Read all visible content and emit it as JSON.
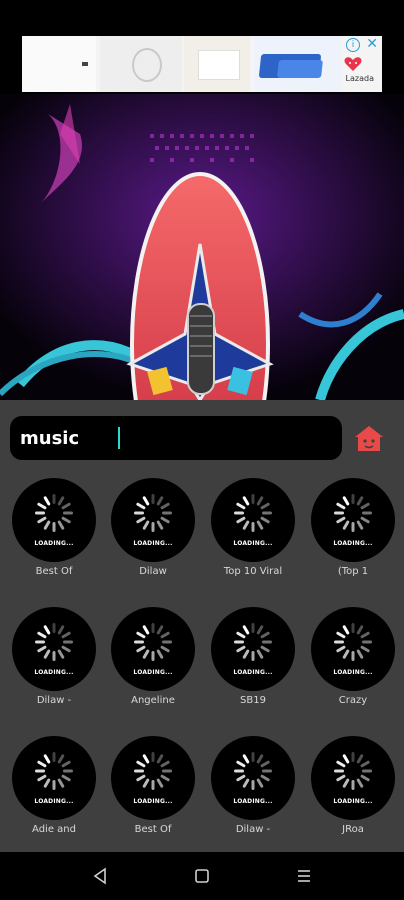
{
  "ad": {
    "brand": "Lazada",
    "info_icon": "info-icon",
    "close_icon": "close-icon",
    "colors": {
      "accent": "#2a9cd8",
      "brand": "#e8344e"
    }
  },
  "search": {
    "value": "music",
    "placeholder": ""
  },
  "home_icon": "home-icon",
  "loading_label": "LOADING...",
  "tiles": [
    {
      "caption": "Best Of"
    },
    {
      "caption": "Dilaw"
    },
    {
      "caption": "Top 10 Viral"
    },
    {
      "caption": "(Top 1"
    },
    {
      "caption": "Dilaw -"
    },
    {
      "caption": "Angeline"
    },
    {
      "caption": "SB19"
    },
    {
      "caption": "Crazy"
    },
    {
      "caption": "Adie and"
    },
    {
      "caption": "Best Of"
    },
    {
      "caption": "Dilaw -"
    },
    {
      "caption": "JRoa"
    }
  ],
  "nav": {
    "back_icon": "back-icon",
    "home_icon": "square-home-icon",
    "menu_icon": "menu-icon"
  },
  "colors": {
    "panel": "#3f3f3f",
    "caret": "#2fd9c8",
    "home": "#e84a4a"
  }
}
